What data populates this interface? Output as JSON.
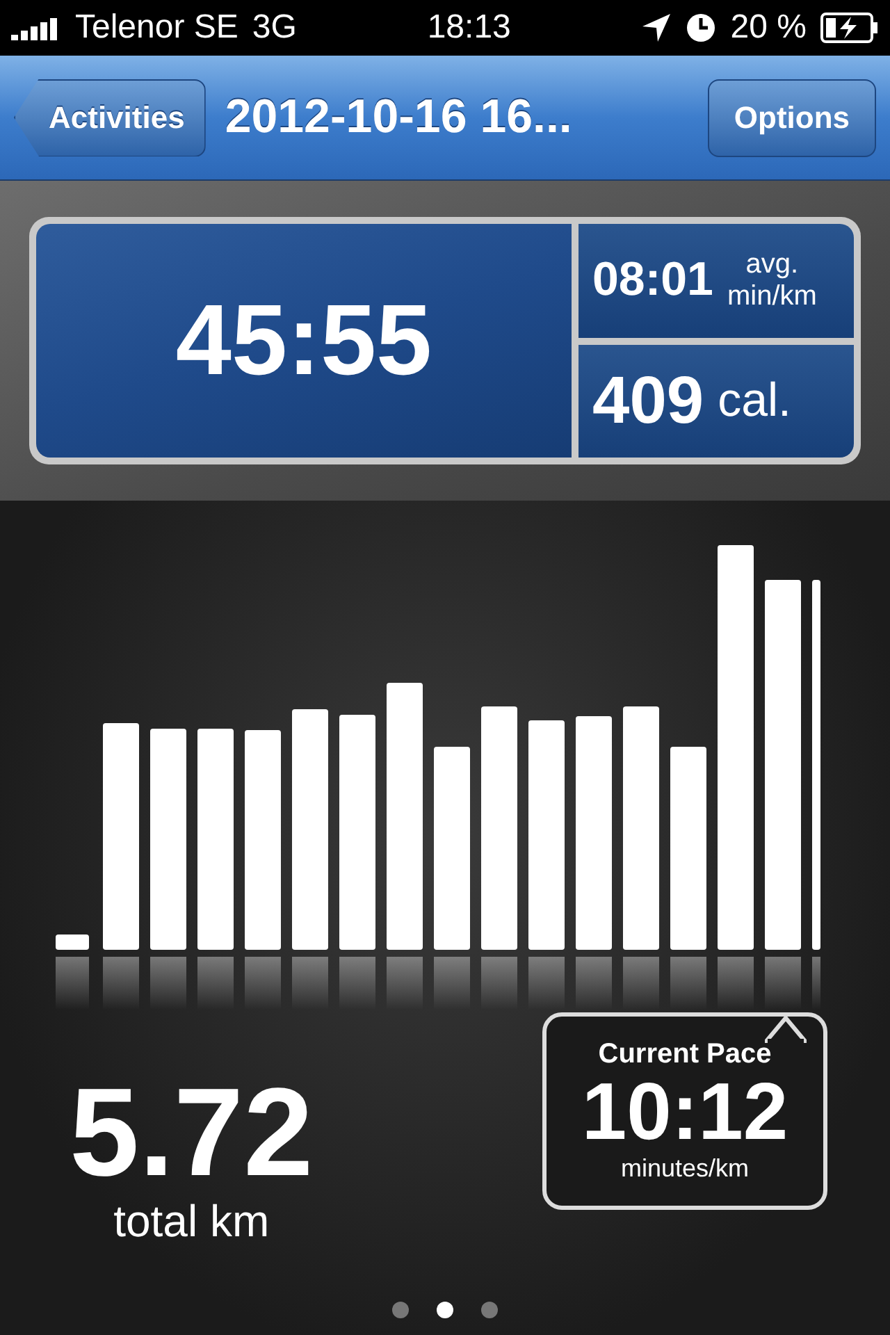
{
  "status_bar": {
    "carrier": "Telenor SE",
    "network": "3G",
    "time": "18:13",
    "battery": "20 %"
  },
  "nav_bar": {
    "back": "Activities",
    "title": "2012-10-16 16...",
    "action": "Options"
  },
  "stats": {
    "duration": "45:55",
    "pace": "08:01",
    "pace_unit_1": "avg.",
    "pace_unit_2": "min/km",
    "calories": "409",
    "calories_unit": "cal."
  },
  "distance": {
    "value": "5.72",
    "unit": "total km"
  },
  "current_pace": {
    "label": "Current Pace",
    "value": "10:12",
    "unit": "minutes/km"
  },
  "page_dots": [
    {
      "selected": false
    },
    {
      "selected": true
    },
    {
      "selected": false
    }
  ]
}
